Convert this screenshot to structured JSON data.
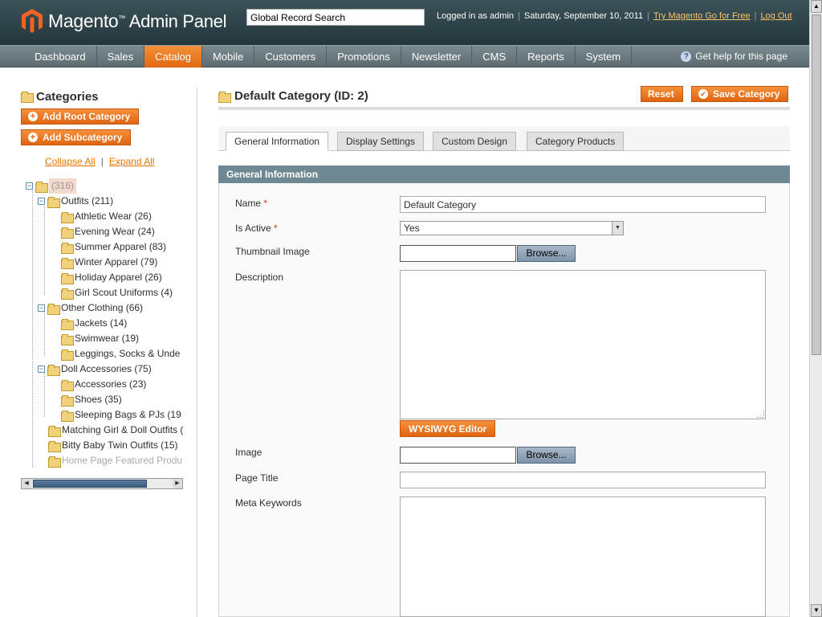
{
  "header": {
    "logo_brand": "Magento",
    "logo_tm": "™",
    "logo_suffix": "Admin Panel",
    "search_value": "Global Record Search",
    "logged_in": "Logged in as admin",
    "date": "Saturday, September 10, 2011",
    "try_link": "Try Magento Go for Free",
    "logout_link": "Log Out"
  },
  "nav": {
    "items": [
      "Dashboard",
      "Sales",
      "Catalog",
      "Mobile",
      "Customers",
      "Promotions",
      "Newsletter",
      "CMS",
      "Reports",
      "System"
    ],
    "active": "Catalog",
    "help": "Get help for this page"
  },
  "sidebar": {
    "title": "Categories",
    "add_root": "Add Root Category",
    "add_sub": "Add Subcategory",
    "collapse_all": "Collapse All",
    "expand_all": "Expand All",
    "tree": [
      {
        "label": "(316)"
      },
      {
        "label": "Outfits (211)"
      },
      {
        "label": "Athletic Wear (26)"
      },
      {
        "label": "Evening Wear (24)"
      },
      {
        "label": "Summer Apparel (83)"
      },
      {
        "label": "Winter Apparel (79)"
      },
      {
        "label": "Holiday Apparel (26)"
      },
      {
        "label": "Girl Scout Uniforms (4)"
      },
      {
        "label": "Other Clothing (66)"
      },
      {
        "label": "Jackets (14)"
      },
      {
        "label": "Swimwear (19)"
      },
      {
        "label": "Leggings, Socks & Unde"
      },
      {
        "label": "Doll Accessories (75)"
      },
      {
        "label": "Accessories (23)"
      },
      {
        "label": "Shoes (35)"
      },
      {
        "label": "Sleeping Bags & PJs (19"
      },
      {
        "label": "Matching Girl & Doll Outfits ("
      },
      {
        "label": "Bitty Baby Twin Outfits (15)"
      },
      {
        "label": "Home Page Featured Produ"
      }
    ]
  },
  "main": {
    "title": "Default Category (ID: 2)",
    "reset": "Reset",
    "save": "Save Category",
    "tabs": [
      "General Information",
      "Display Settings",
      "Custom Design",
      "Category Products"
    ],
    "section_title": "General Information",
    "fields": {
      "name_label": "Name",
      "name_value": "Default Category",
      "active_label": "Is Active",
      "active_value": "Yes",
      "thumb_label": "Thumbnail Image",
      "browse": "Browse...",
      "desc_label": "Description",
      "wysiwyg": "WYSIWYG Editor",
      "image_label": "Image",
      "page_title_label": "Page Title",
      "meta_keywords_label": "Meta Keywords",
      "required_mark": "*"
    }
  }
}
